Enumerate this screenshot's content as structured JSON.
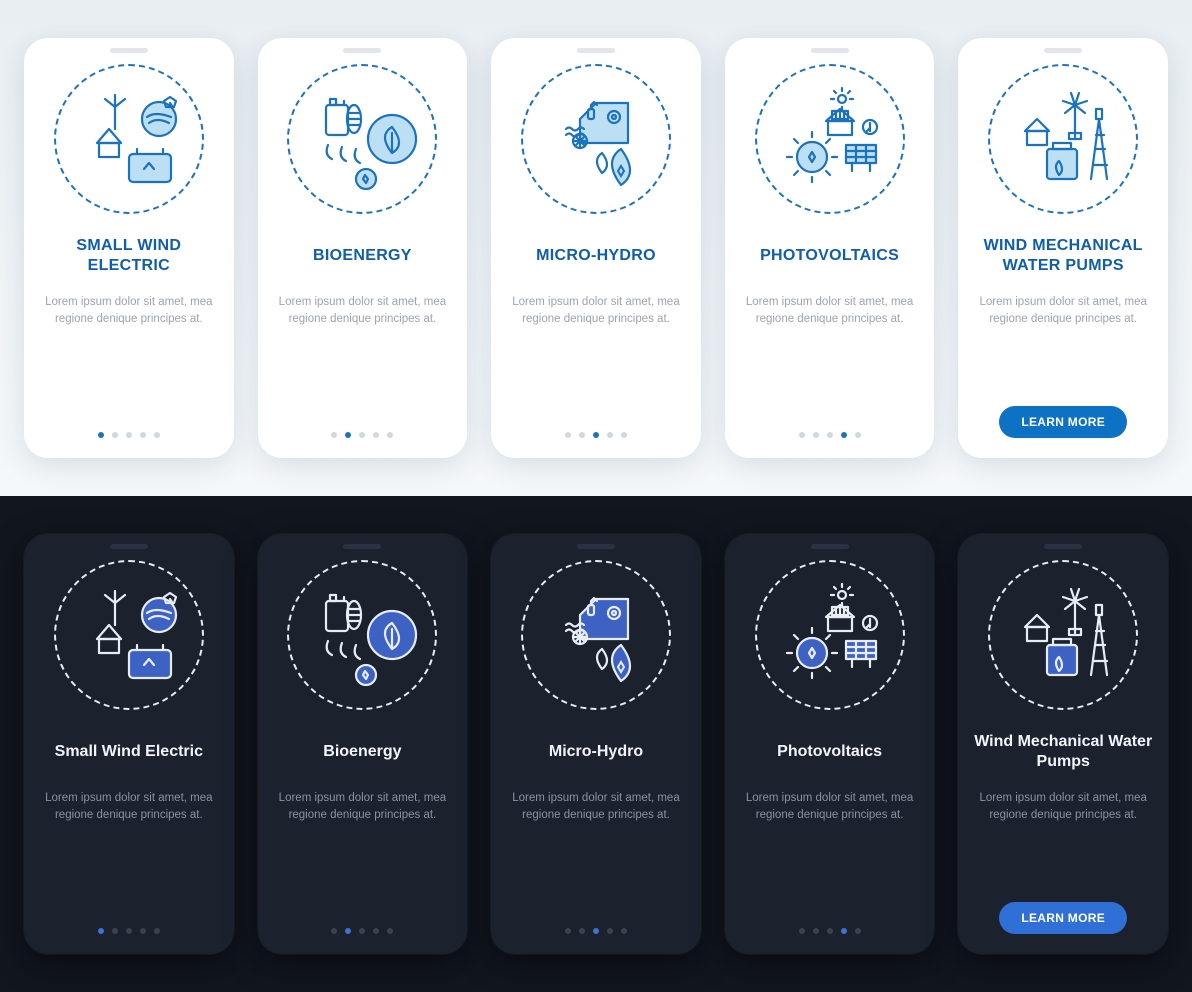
{
  "lorem": "Lorem ipsum dolor sit amet, mea regione denique principes at.",
  "cta_label": "LEARN MORE",
  "cards": [
    {
      "title_light": "SMALL WIND ELECTRIC",
      "title_dark": "Small Wind Electric",
      "icon": "wind",
      "active_dot": 0
    },
    {
      "title_light": "BIOENERGY",
      "title_dark": "Bioenergy",
      "icon": "bio",
      "active_dot": 1
    },
    {
      "title_light": "MICRO-HYDRO",
      "title_dark": "Micro-Hydro",
      "icon": "hydro",
      "active_dot": 2
    },
    {
      "title_light": "PHOTOVOLTAICS",
      "title_dark": "Photovoltaics",
      "icon": "pv",
      "active_dot": 3
    },
    {
      "title_light": "WIND MECHANICAL WATER PUMPS",
      "title_dark": "Wind Mechanical Water Pumps",
      "icon": "pump",
      "active_dot": 4,
      "cta": true
    }
  ],
  "colors": {
    "light_stroke": "#1b73be",
    "light_fill": "#bcdff4",
    "dark_stroke": "#e8edf5",
    "dark_fill": "#3d62c4"
  }
}
